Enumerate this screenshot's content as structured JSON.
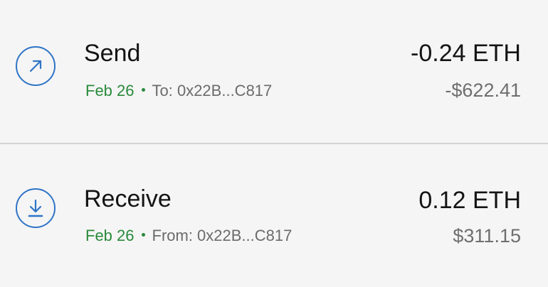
{
  "colors": {
    "accent": "#2f74c7",
    "date_green": "#2a8a3c",
    "primary_text": "#141414",
    "secondary_text": "#6b6b6b",
    "background": "#f5f5f5",
    "divider": "#d4d4d4"
  },
  "transactions": [
    {
      "icon": "arrow-up-right-icon",
      "title": "Send",
      "date": "Feb 26",
      "address": "To: 0x22B...C817",
      "amount": "-0.24 ETH",
      "fiat": "-$622.41"
    },
    {
      "icon": "download-icon",
      "title": "Receive",
      "date": "Feb 26",
      "address": "From: 0x22B...C817",
      "amount": "0.12 ETH",
      "fiat": "$311.15"
    }
  ]
}
